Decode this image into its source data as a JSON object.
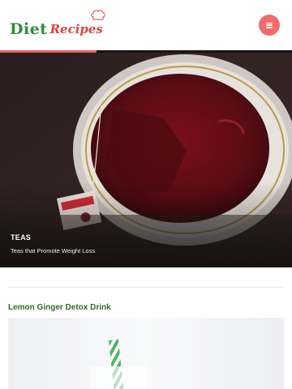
{
  "header": {
    "logo": {
      "word1": "Diet",
      "word2": "Recipes"
    },
    "menu_icon": "hamburger-menu-icon",
    "menu_color": "#f26b6b"
  },
  "hero": {
    "category": "TEAS",
    "title": "Teas that Promote Weight Loss",
    "slider_progress": 0.33,
    "image_subject": "cup of tea with tea bag"
  },
  "posts": [
    {
      "title": "Lemon Ginger Detox Drink",
      "image_subject": "glass with striped straw"
    }
  ],
  "colors": {
    "brand_green": "#2e8b3a",
    "brand_red": "#e0443c",
    "accent": "#f16363",
    "post_title": "#2e6b2a"
  }
}
